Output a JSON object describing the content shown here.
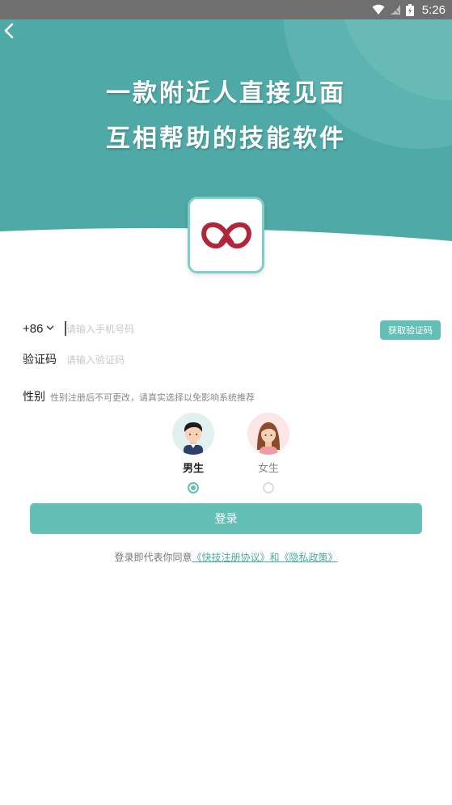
{
  "status_bar": {
    "time": "5:26",
    "icons": [
      "wifi-icon",
      "signal-icon",
      "battery-icon"
    ]
  },
  "header": {
    "back_icon": "chevron-left-icon",
    "slogan_line1": "一款附近人直接见面",
    "slogan_line2": "互相帮助的技能软件"
  },
  "form": {
    "country_code": "+86",
    "phone_placeholder": "请输入手机号码",
    "get_code_label": "获取验证码",
    "code_label": "验证码",
    "code_placeholder": "请输入验证码",
    "gender_label": "性别",
    "gender_hint": "性别注册后不可更改，请真实选择以免影响系统推荐",
    "genders": [
      {
        "label": "男生",
        "selected": true
      },
      {
        "label": "女生",
        "selected": false
      }
    ]
  },
  "login_label": "登录",
  "agreement": {
    "prefix": "登录即代表你同意",
    "link": "《快技注册协议》和《隐私政策》"
  },
  "colors": {
    "primary": "#64c0b6",
    "hero_bg": "#4fa9a6",
    "logo_red": "#b0263a"
  }
}
